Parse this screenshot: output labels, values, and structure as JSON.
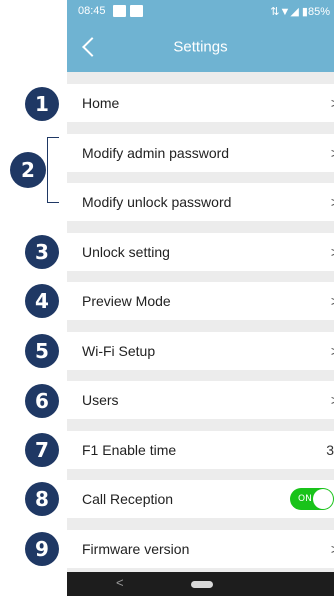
{
  "status_bar": {
    "time": "08:45",
    "right_text": "⇅▼◢ ▮85%"
  },
  "header": {
    "title": "Settings"
  },
  "markers": [
    "1",
    "2",
    "3",
    "4",
    "5",
    "6",
    "7",
    "8",
    "9"
  ],
  "settings": {
    "home": "Home",
    "modify_admin_password": "Modify admin password",
    "modify_unlock_password": "Modify unlock password",
    "unlock_setting": "Unlock setting",
    "preview_mode": "Preview Mode",
    "wifi_setup": "Wi-Fi Setup",
    "users": "Users",
    "f1_enable_time": {
      "label": "F1 Enable time",
      "value": "3"
    },
    "call_reception": {
      "label": "Call Reception",
      "toggle": "ON"
    },
    "firmware_version": "Firmware version"
  },
  "chevron": ">",
  "nav": {
    "back": "<"
  },
  "colors": {
    "header": "#6fb3d2",
    "marker": "#1f3864",
    "toggle_on": "#19c31a"
  }
}
